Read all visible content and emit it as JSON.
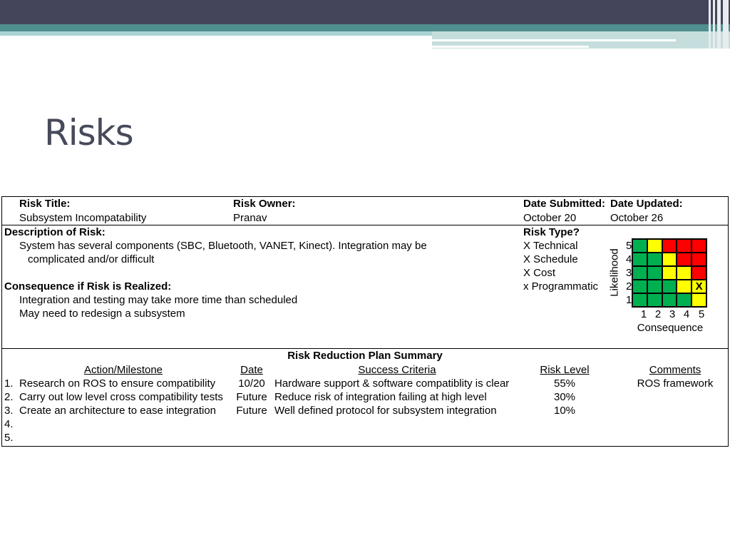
{
  "slide": {
    "title": "Risks"
  },
  "form": {
    "risk_title_label": "Risk Title:",
    "risk_title": "Subsystem Incompatability",
    "risk_owner_label": "Risk Owner:",
    "risk_owner": "Pranav",
    "date_submitted_label": "Date Submitted:",
    "date_submitted": "October 20",
    "date_updated_label": "Date Updated:",
    "date_updated": "October 26",
    "description_label": "Description of Risk:",
    "description_line1": "System has several components (SBC, Bluetooth, VANET, Kinect).  Integration may be",
    "description_line2": "complicated and/or difficult",
    "consequence_label": "Consequence if Risk is Realized:",
    "consequence_line1": "Integration and testing may take more time than scheduled",
    "consequence_line2": "May need to redesign a subsystem",
    "risk_type_label": "Risk Type?",
    "risk_types": [
      "X Technical",
      "X Schedule",
      "X Cost",
      "x Programmatic"
    ]
  },
  "matrix": {
    "likelihood_label": "Likelihood",
    "consequence_label": "Consequence",
    "likelihood_ticks": [
      "5",
      "4",
      "3",
      "2",
      "1"
    ],
    "consequence_ticks": [
      "1",
      "2",
      "3",
      "4",
      "5"
    ],
    "colors": {
      "green": "#00b050",
      "yellow": "#ffff00",
      "red": "#ff0000"
    },
    "rows": [
      [
        "green",
        "yellow",
        "red",
        "red",
        "red"
      ],
      [
        "green",
        "green",
        "yellow",
        "red",
        "red"
      ],
      [
        "green",
        "green",
        "yellow",
        "yellow",
        "red"
      ],
      [
        "green",
        "green",
        "green",
        "yellow",
        "yellow"
      ],
      [
        "green",
        "green",
        "green",
        "green",
        "yellow"
      ]
    ],
    "marked": {
      "likelihood": 2,
      "consequence": 5,
      "mark": "X"
    }
  },
  "plan": {
    "title": "Risk Reduction Plan Summary",
    "headers": {
      "action": "Action/Milestone",
      "date": "Date",
      "criteria": "Success Criteria",
      "level": "Risk Level",
      "comments": "Comments"
    },
    "rows": [
      {
        "num": "1.",
        "action": "Research on ROS to ensure compatibility",
        "date": "10/20",
        "criteria": "Hardware support & software compatiblity is clear",
        "level": "55%",
        "comments": "ROS framework"
      },
      {
        "num": "2.",
        "action": "Carry out low level cross compatibility tests",
        "date": "Future",
        "criteria": "Reduce risk of integration failing at high level",
        "level": "30%",
        "comments": ""
      },
      {
        "num": "3.",
        "action": "Create an architecture to ease integration",
        "date": "Future",
        "criteria": "Well defined protocol for subsystem integration",
        "level": "10%",
        "comments": ""
      },
      {
        "num": "4.",
        "action": "",
        "date": "",
        "criteria": "",
        "level": "",
        "comments": ""
      },
      {
        "num": "5.",
        "action": "",
        "date": "",
        "criteria": "",
        "level": "",
        "comments": ""
      }
    ]
  }
}
